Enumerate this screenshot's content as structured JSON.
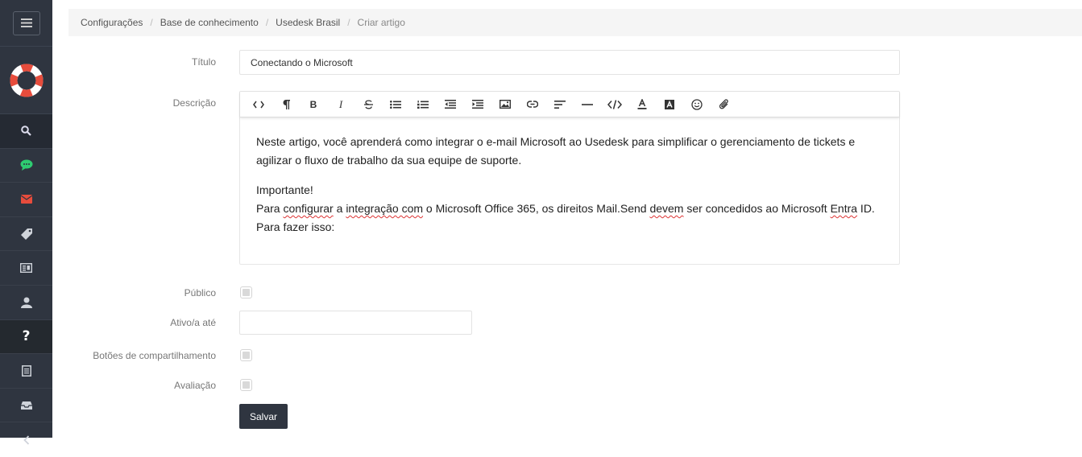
{
  "breadcrumb": {
    "items": [
      "Configurações",
      "Base de conhecimento",
      "Usedesk Brasil"
    ],
    "separator": "/",
    "current": "Criar artigo"
  },
  "sidebar": {
    "items": [
      {
        "icon": "search-icon"
      },
      {
        "icon": "chat-icon",
        "color": "#2ecc71"
      },
      {
        "icon": "mail-icon",
        "color": "#e74c3c"
      },
      {
        "icon": "tag-icon"
      },
      {
        "icon": "contact-card-icon"
      },
      {
        "icon": "user-icon"
      },
      {
        "icon": "question-icon",
        "label": "?"
      },
      {
        "icon": "document-icon"
      },
      {
        "icon": "inbox-icon"
      },
      {
        "icon": "chevron-left-icon"
      }
    ]
  },
  "form": {
    "title_label": "Título",
    "title_value": "Conectando o Microsoft",
    "description_label": "Descrição",
    "public_label": "Público",
    "active_until_label": "Ativo/a até",
    "active_until_value": "",
    "share_buttons_label": "Botões de compartilhamento",
    "rating_label": "Avaliação",
    "save_label": "Salvar"
  },
  "editor": {
    "toolbar": [
      "code-view-icon",
      "paragraph-icon",
      "bold-icon",
      "italic-icon",
      "strikethrough-icon",
      "unordered-list-icon",
      "ordered-list-icon",
      "outdent-icon",
      "indent-icon",
      "image-icon",
      "link-icon",
      "align-icon",
      "horizontal-rule-icon",
      "code-icon",
      "font-color-icon",
      "background-color-icon",
      "emoji-icon",
      "attachment-icon"
    ],
    "bold_glyph": "B",
    "italic_glyph": "I",
    "content": {
      "p1": "Neste artigo, você aprenderá como integrar o e-mail Microsoft ao Usedesk para simplificar o gerenciamento de tickets e agilizar o fluxo de trabalho da sua equipe de suporte.",
      "important": "Importante!",
      "l2_a": "Para ",
      "l2_w1": "configurar",
      "l2_b": " a ",
      "l2_w2": "integração com",
      "l2_c": " o Microsoft Office 365, os direitos Mail.Send ",
      "l2_w3": "devem",
      "l2_d": " ser concedidos ao Microsoft ",
      "l2_w4": "Entra",
      "l2_e": " ID.",
      "l3": "Para fazer isso:"
    }
  },
  "colors": {
    "sidebar_bg": "#2f3540",
    "chat_icon": "#2ecc71",
    "mail_icon": "#e74c3c",
    "save_button_bg": "#2f3540"
  }
}
